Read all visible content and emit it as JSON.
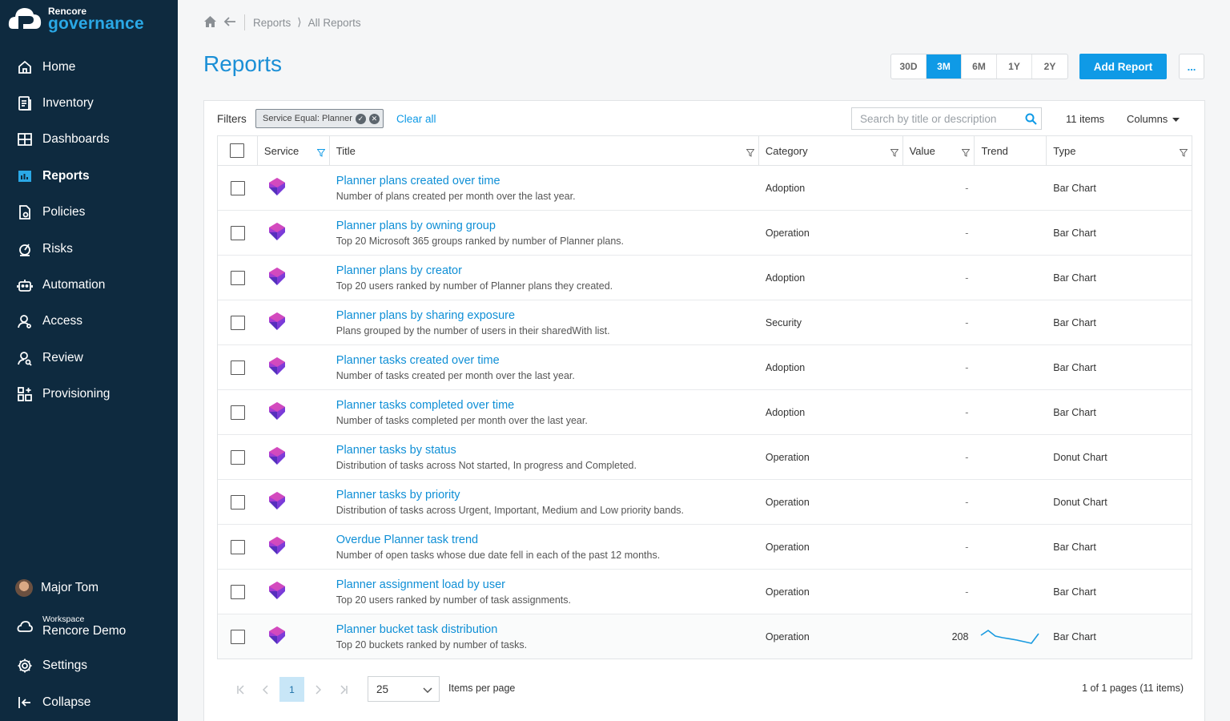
{
  "brand": {
    "top": "Rencore",
    "bottom": "governance"
  },
  "nav": [
    {
      "label": "Home",
      "icon": "home-icon",
      "active": false
    },
    {
      "label": "Inventory",
      "icon": "inventory-icon",
      "active": false
    },
    {
      "label": "Dashboards",
      "icon": "dashboards-icon",
      "active": false
    },
    {
      "label": "Reports",
      "icon": "reports-icon",
      "active": true
    },
    {
      "label": "Policies",
      "icon": "policies-icon",
      "active": false
    },
    {
      "label": "Risks",
      "icon": "risks-icon",
      "active": false
    },
    {
      "label": "Automation",
      "icon": "robot-icon",
      "active": false
    },
    {
      "label": "Access",
      "icon": "access-icon",
      "active": false
    },
    {
      "label": "Review",
      "icon": "review-icon",
      "active": false
    },
    {
      "label": "Provisioning",
      "icon": "provisioning-icon",
      "active": false
    }
  ],
  "user": {
    "name": "Major Tom"
  },
  "workspace": {
    "label": "Workspace",
    "name": "Rencore Demo"
  },
  "settings_label": "Settings",
  "collapse_label": "Collapse",
  "breadcrumb": {
    "root": "Reports",
    "current": "All Reports"
  },
  "page_title": "Reports",
  "ranges": [
    {
      "label": "30D",
      "active": false
    },
    {
      "label": "3M",
      "active": true
    },
    {
      "label": "6M",
      "active": false
    },
    {
      "label": "1Y",
      "active": false
    },
    {
      "label": "2Y",
      "active": false
    }
  ],
  "add_report_label": "Add Report",
  "more_label": "...",
  "filters": {
    "label": "Filters",
    "chip": "Service Equal: Planner",
    "clear_all": "Clear all"
  },
  "search": {
    "placeholder": "Search by title or description",
    "value": ""
  },
  "items_count": "11 items",
  "columns_label": "Columns",
  "table": {
    "headers": {
      "service": "Service",
      "title": "Title",
      "category": "Category",
      "value": "Value",
      "trend": "Trend",
      "type": "Type"
    },
    "rows": [
      {
        "title": "Planner plans created over time",
        "desc": "Number of plans created per month over the last year.",
        "category": "Adoption",
        "value": "-",
        "trend": null,
        "type": "Bar Chart"
      },
      {
        "title": "Planner plans by owning group",
        "desc": "Top 20 Microsoft 365 groups ranked by number of Planner plans.",
        "category": "Operation",
        "value": "-",
        "trend": null,
        "type": "Bar Chart"
      },
      {
        "title": "Planner plans by creator",
        "desc": "Top 20 users ranked by number of Planner plans they created.",
        "category": "Adoption",
        "value": "-",
        "trend": null,
        "type": "Bar Chart"
      },
      {
        "title": "Planner plans by sharing exposure",
        "desc": "Plans grouped by the number of users in their sharedWith list.",
        "category": "Security",
        "value": "-",
        "trend": null,
        "type": "Bar Chart"
      },
      {
        "title": "Planner tasks created over time",
        "desc": "Number of tasks created per month over the last year.",
        "category": "Adoption",
        "value": "-",
        "trend": null,
        "type": "Bar Chart"
      },
      {
        "title": "Planner tasks completed over time",
        "desc": "Number of tasks completed per month over the last year.",
        "category": "Adoption",
        "value": "-",
        "trend": null,
        "type": "Bar Chart"
      },
      {
        "title": "Planner tasks by status",
        "desc": "Distribution of tasks across Not started, In progress and Completed.",
        "category": "Operation",
        "value": "-",
        "trend": null,
        "type": "Donut Chart"
      },
      {
        "title": "Planner tasks by priority",
        "desc": "Distribution of tasks across Urgent, Important, Medium and Low priority bands.",
        "category": "Operation",
        "value": "-",
        "trend": null,
        "type": "Donut Chart"
      },
      {
        "title": "Overdue Planner task trend",
        "desc": "Number of open tasks whose due date fell in each of the past 12 months.",
        "category": "Operation",
        "value": "-",
        "trend": null,
        "type": "Bar Chart"
      },
      {
        "title": "Planner assignment load by user",
        "desc": "Top 20 users ranked by number of task assignments.",
        "category": "Operation",
        "value": "-",
        "trend": null,
        "type": "Bar Chart"
      },
      {
        "title": "Planner bucket task distribution",
        "desc": "Top 20 buckets ranked by number of tasks.",
        "category": "Operation",
        "value": "208",
        "trend": [
          0.6,
          0.9,
          0.55,
          0.45,
          0.38,
          0.3,
          0.2,
          0.1,
          0.7
        ],
        "type": "Bar Chart"
      }
    ]
  },
  "pagination": {
    "current_page": "1",
    "per_page": "25",
    "per_page_label": "Items per page",
    "summary": "1 of 1 pages (11 items)"
  },
  "colors": {
    "accent": "#0f9ae6",
    "sidebar": "#0e2a3f",
    "link": "#0f8fd6"
  }
}
